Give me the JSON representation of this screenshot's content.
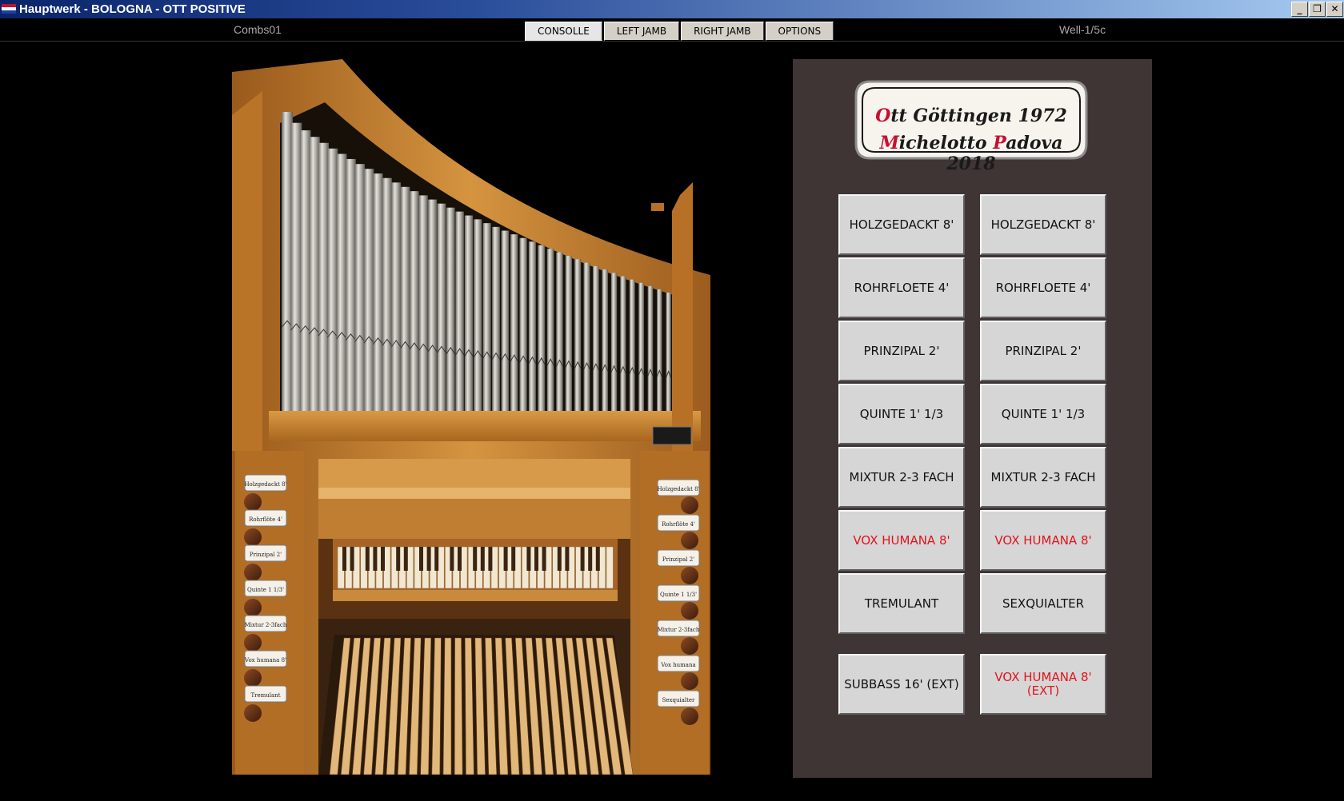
{
  "window": {
    "title": "Hauptwerk - BOLOGNA - OTT POSITIVE",
    "minimize": "_",
    "restore": "❐",
    "close": "✕"
  },
  "toolbar": {
    "left_label": "Combs01",
    "right_label": "Well-1/5c",
    "tabs": [
      {
        "label": "CONSOLLE",
        "active": true
      },
      {
        "label": "LEFT JAMB",
        "active": false
      },
      {
        "label": "RIGHT JAMB",
        "active": false
      },
      {
        "label": "OPTIONS",
        "active": false
      }
    ]
  },
  "plaque": {
    "line1_cap": "O",
    "line1_rest": "tt Göttingen 1972",
    "line2_cap1": "M",
    "line2_mid": "ichelotto ",
    "line2_cap2": "P",
    "line2_rest": "adova 2018"
  },
  "stops": {
    "left": [
      {
        "label": "HOLZGEDACKT 8'",
        "color": "#111111"
      },
      {
        "label": "ROHRFLOETE 4'",
        "color": "#111111"
      },
      {
        "label": "PRINZIPAL 2'",
        "color": "#111111"
      },
      {
        "label": "QUINTE 1' 1/3",
        "color": "#111111"
      },
      {
        "label": "MIXTUR 2-3 FACH",
        "color": "#111111"
      },
      {
        "label": "VOX HUMANA 8'",
        "color": "#e0141c"
      },
      {
        "label": "TREMULANT",
        "color": "#111111"
      },
      {
        "label": "SUBBASS 16' (EXT)",
        "color": "#111111"
      }
    ],
    "right": [
      {
        "label": "HOLZGEDACKT 8'",
        "color": "#111111"
      },
      {
        "label": "ROHRFLOETE 4'",
        "color": "#111111"
      },
      {
        "label": "PRINZIPAL 2'",
        "color": "#111111"
      },
      {
        "label": "QUINTE 1' 1/3",
        "color": "#111111"
      },
      {
        "label": "MIXTUR 2-3 FACH",
        "color": "#111111"
      },
      {
        "label": "VOX HUMANA 8'",
        "color": "#e0141c"
      },
      {
        "label": "SEXQUIALTER",
        "color": "#111111"
      },
      {
        "label": "VOX HUMANA 8' (EXT)",
        "color": "#e0141c"
      }
    ]
  },
  "jamb_labels": {
    "left": [
      "Holzgedackt 8'",
      "Rohrflöte 4'",
      "Prinzipal 2'",
      "Quinte 1 1/3'",
      "Mixtur 2-3fach",
      "Vox humana 8'",
      "Tremulant"
    ],
    "right": [
      "Holzgedackt 8'",
      "Rohrflöte 4'",
      "Prinzipal 2'",
      "Quinte 1 1/3'",
      "Mixtur 2-3fach",
      "Vox humana",
      "Sexquialter"
    ]
  },
  "colors": {
    "panel_bg": "#3f3535",
    "stop_bg": "#d6d6d6",
    "stop_red": "#e0141c",
    "wood": "#c9832f"
  }
}
